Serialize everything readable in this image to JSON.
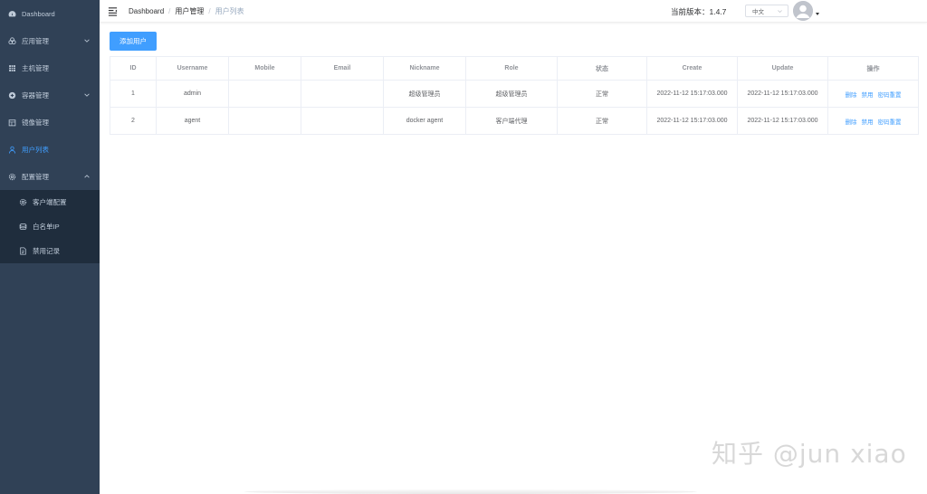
{
  "sidebar": {
    "items": [
      {
        "label": "Dashboard",
        "icon": "dashboard-icon"
      },
      {
        "label": "应用管理",
        "icon": "apps-icon",
        "expandable": true
      },
      {
        "label": "主机管理",
        "icon": "host-icon"
      },
      {
        "label": "容器管理",
        "icon": "container-icon",
        "expandable": true
      },
      {
        "label": "镜像管理",
        "icon": "image-icon"
      },
      {
        "label": "用户列表",
        "icon": "user-icon",
        "active": true
      },
      {
        "label": "配置管理",
        "icon": "settings-icon",
        "expanded": true
      }
    ],
    "submenu": [
      {
        "label": "客户端配置",
        "icon": "gear-icon"
      },
      {
        "label": "白名单IP",
        "icon": "whitelist-icon"
      },
      {
        "label": "禁用记录",
        "icon": "document-icon"
      }
    ]
  },
  "topbar": {
    "breadcrumb": [
      "Dashboard",
      "用户管理",
      "用户列表"
    ],
    "version_label": "当前版本：1.4.7",
    "language": "中文"
  },
  "main": {
    "add_button": "添加用户",
    "table": {
      "headers": [
        "ID",
        "Username",
        "Mobile",
        "Email",
        "Nickname",
        "Role",
        "状态",
        "Create",
        "Update",
        "操作"
      ],
      "rows": [
        [
          "1",
          "admin",
          "",
          "",
          "超级管理员",
          "超级管理员",
          "正常",
          "2022-11-12 15:17:03.000",
          "2022-11-12 15:17:03.000"
        ],
        [
          "2",
          "agent",
          "",
          "",
          "docker agent",
          "客户端代理",
          "正常",
          "2022-11-12 15:17:03.000",
          "2022-11-12 15:17:03.000"
        ]
      ],
      "actions": [
        "删除",
        "禁用",
        "密码重置"
      ]
    }
  },
  "watermark": "知乎 @jun xiao",
  "colors": {
    "sidebar_bg": "#304156",
    "submenu_bg": "#1f2d3d",
    "sidebar_text": "#bfcbd9",
    "primary": "#409eff"
  }
}
